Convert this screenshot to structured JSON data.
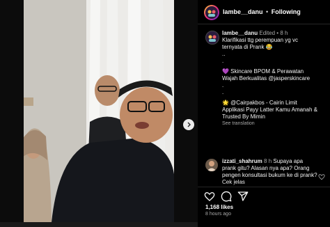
{
  "header": {
    "username": "lambe__danu",
    "separator": "•",
    "follow_label": "Following"
  },
  "caption": {
    "username": "lambe__danu",
    "edited": "Edited",
    "separator": "•",
    "time": "8 h",
    "line1": "Klarifikasi ttg perempuan yg vc",
    "line2": "ternyata di Prank 😂",
    "dots1": "..",
    "dot2": ".",
    "skincare1": "💜 Skincare BPOM & Perawatan",
    "skincare2": "Wajah Berkualitas @jasperskincare",
    "dot3": ".",
    "dot4": ".",
    "cair1": "🌟 @Cairpakbos - Cairin Limit",
    "cair2": "Applikasi Payy Latter Kamu Amanah &",
    "cair3": "Trusted By Mimin",
    "see_translation": "See translation"
  },
  "comment": {
    "username": "izzati_shahrum",
    "time": "8 h",
    "line1": "Supaya apa prank gitu? Alasan nya",
    "line2": "apa? Orang pengen konsultasi",
    "line3": "bukum ke di prank? Cek jelas"
  },
  "actions": {
    "likes": "1,168 likes",
    "ago": "8 hours ago"
  },
  "icons": {
    "like": "heart-icon",
    "comment": "comment-icon",
    "share": "share-icon",
    "next": "chevron-right-icon",
    "comment_like": "heart-icon"
  }
}
